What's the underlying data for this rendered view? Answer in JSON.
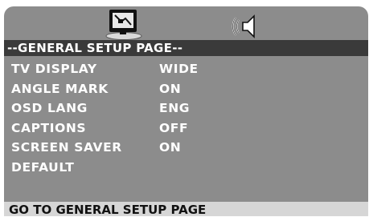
{
  "tabs": [
    {
      "icon": "general-setup-monitor-icon",
      "active": true
    },
    {
      "icon": "audio-speaker-icon",
      "active": false
    }
  ],
  "header": {
    "title": "--GENERAL SETUP PAGE--"
  },
  "menu": {
    "items": [
      {
        "label": "TV DISPLAY",
        "value": "WIDE"
      },
      {
        "label": "ANGLE MARK",
        "value": "ON"
      },
      {
        "label": "OSD LANG",
        "value": "ENG"
      },
      {
        "label": "CAPTIONS",
        "value": "OFF"
      },
      {
        "label": "SCREEN SAVER",
        "value": "ON"
      },
      {
        "label": "DEFAULT",
        "value": ""
      }
    ]
  },
  "status": {
    "text": "GO TO GENERAL SETUP PAGE"
  },
  "colors": {
    "panel": "#8c8c8c",
    "header_bar": "#3a3a3a",
    "status_bar": "#d6d6d6",
    "text": "#ffffff"
  }
}
